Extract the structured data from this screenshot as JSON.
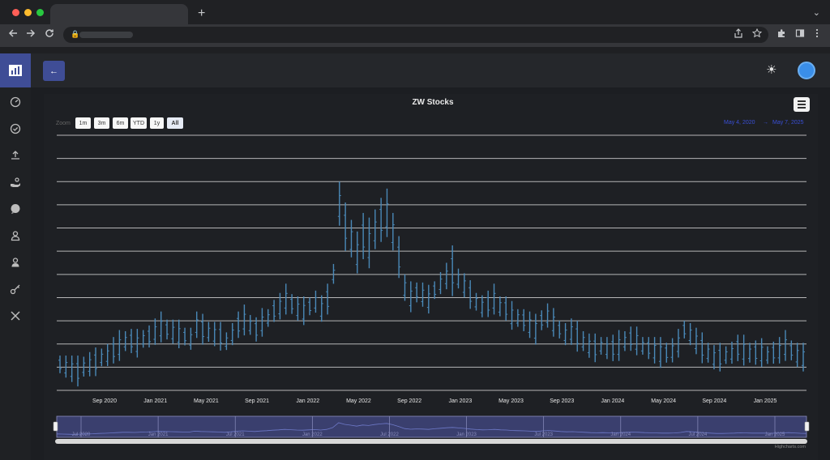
{
  "browser": {
    "new_tab": "+",
    "caret": "⌄"
  },
  "header": {
    "back_icon": "←",
    "theme_icon": "☀"
  },
  "sidebar": {
    "items": [
      "chart-icon",
      "dashboard-icon",
      "check-icon",
      "upload-icon",
      "hand-coins-icon",
      "chat-icon",
      "user-icon",
      "user-badge-icon",
      "key-icon",
      "tools-icon"
    ]
  },
  "chart": {
    "zoom_label": "Zoom",
    "zoom_buttons": [
      "1m",
      "3m",
      "6m",
      "YTD",
      "1y",
      "All"
    ],
    "range_from": "May 4, 2020",
    "range_arrow": "→",
    "range_to": "May 7, 2025",
    "credits": "Highcharts.com"
  },
  "chart_data": {
    "type": "candlestick",
    "title": "ZW Stocks",
    "xlabel": "",
    "ylabel": "",
    "x_ticks": [
      "Sep 2020",
      "Jan 2021",
      "May 2021",
      "Sep 2021",
      "Jan 2022",
      "May 2022",
      "Sep 2022",
      "Jan 2023",
      "May 2023",
      "Sep 2023",
      "Jan 2024",
      "May 2024",
      "Sep 2024",
      "Jan 2025"
    ],
    "navigator_ticks": [
      "Jul 2020",
      "Jan 2021",
      "Jul 2021",
      "Jan 2022",
      "Jul 2022",
      "Jan 2023",
      "Jul 2023",
      "Jan 2024",
      "Jul 2024",
      "Jan 2025"
    ],
    "ylim": [
      0,
      11
    ],
    "grid": true,
    "series": [
      {
        "values": [
          1.1,
          1.0,
          0.9,
          0.8,
          1.0,
          1.1,
          1.2,
          1.4,
          1.5,
          1.7,
          1.9,
          2.1,
          2.1,
          2.0,
          2.2,
          2.3,
          2.5,
          2.7,
          2.6,
          2.5,
          2.4,
          2.3,
          2.2,
          2.8,
          2.6,
          2.5,
          2.4,
          2.3,
          2.1,
          2.4,
          2.8,
          3.0,
          2.8,
          2.6,
          2.9,
          3.1,
          3.4,
          3.6,
          3.9,
          3.7,
          3.5,
          3.4,
          3.6,
          3.8,
          3.5,
          3.9,
          5.0,
          8.0,
          7.0,
          6.5,
          5.9,
          6.6,
          6.3,
          6.9,
          7.3,
          7.6,
          6.8,
          5.7,
          4.4,
          4.0,
          4.2,
          4.1,
          3.9,
          4.3,
          4.6,
          4.9,
          5.1,
          4.8,
          4.5,
          4.1,
          3.8,
          3.6,
          3.7,
          3.9,
          3.6,
          3.5,
          3.2,
          3.1,
          3.0,
          2.8,
          2.6,
          3.0,
          3.2,
          2.9,
          2.6,
          2.4,
          2.5,
          2.3,
          2.1,
          1.9,
          1.8,
          1.9,
          1.8,
          1.8,
          1.9,
          2.1,
          2.2,
          2.1,
          1.9,
          1.8,
          1.7,
          1.6,
          1.6,
          1.7,
          2.0,
          2.6,
          2.4,
          2.1,
          1.8,
          1.6,
          1.4,
          1.4,
          1.5,
          1.6,
          1.8,
          1.7,
          1.6,
          1.6,
          1.6,
          1.5,
          1.6,
          1.7,
          1.9,
          1.7,
          1.5,
          1.4
        ]
      }
    ]
  },
  "colors": {
    "accent": "#3f4d96",
    "series": "#4a89b8",
    "grid": "#d0d0d0",
    "navigator_fill": "#3a3f6e"
  }
}
